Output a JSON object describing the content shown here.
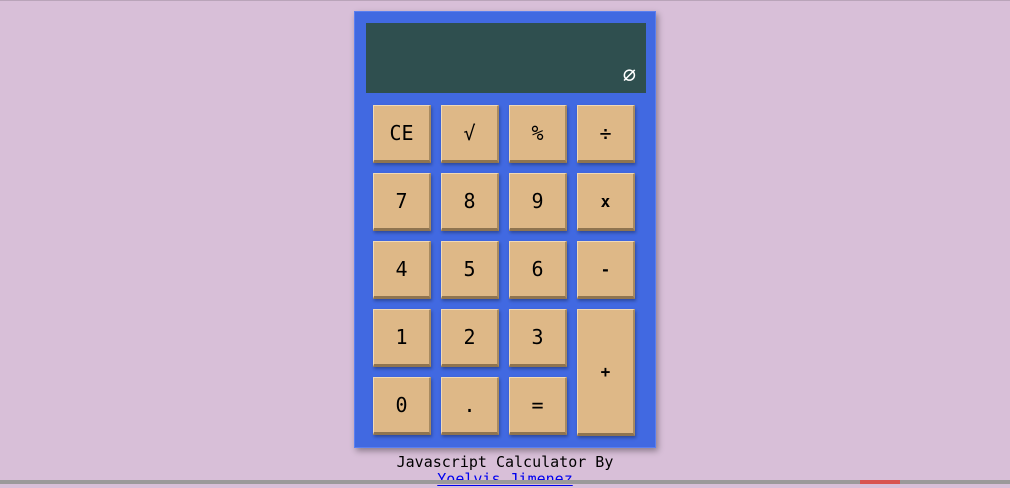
{
  "display": {
    "value": "∅"
  },
  "keys": {
    "ce": "CE",
    "sqrt": "√",
    "percent": "%",
    "divide": "÷",
    "seven": "7",
    "eight": "8",
    "nine": "9",
    "multiply": "x",
    "four": "4",
    "five": "5",
    "six": "6",
    "minus": "-",
    "one": "1",
    "two": "2",
    "three": "3",
    "plus": "+",
    "zero": "0",
    "decimal": ".",
    "equals": "="
  },
  "footer": {
    "text": "Javascript Calculator By",
    "author_link": "Yoelvis Jimenez"
  },
  "colors": {
    "background": "#d8bfd8",
    "calculator_body": "#4169e1",
    "display": "#2f4f4f",
    "key": "#deb887",
    "link": "#0000ee"
  }
}
